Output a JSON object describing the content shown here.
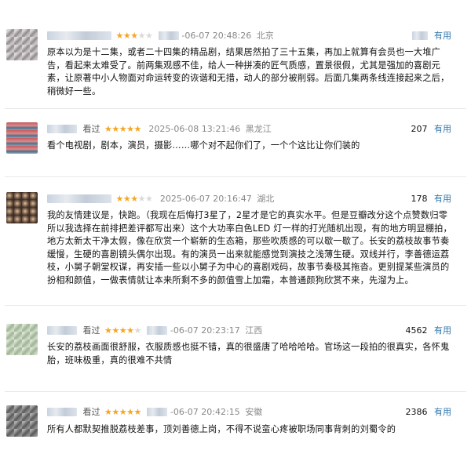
{
  "reviews": [
    {
      "status": "",
      "rating": 3,
      "time": "-06-07 20:48:26",
      "location": "北京",
      "count": "",
      "useful_label": "有用",
      "content": "原本以为是十二集，或者二十四集的精品剧，结果居然拍了三十五集，再加上就算有会员也一大堆广告，看起来太难受了。前两集观感不佳，给人一种拼凑的匠气质感，置景很假，尤其是强加的喜剧元素，让原著中小人物面对命运转变的诙谐和无措，动人的部分被削弱。后面几集两条线连接起来之后，稍微好一些。"
    },
    {
      "status": "看过",
      "rating": 5,
      "time": "2025-06-08 13:21:46",
      "location": "黑龙江",
      "count": "207",
      "useful_label": "有用",
      "content": "看个电视剧，剧本，演员，摄影……哪个对不起你们了，一个个这比让你们装的"
    },
    {
      "status": "",
      "rating": 3,
      "time": "2025-06-07 20:16:47",
      "location": "湖北",
      "count": "178",
      "useful_label": "有用",
      "content": "我的友情建议是，快跑。（我现在后悔打3星了，2星才是它的真实水平。但是豆瓣改分这个点赞数归零所以我选择在前排把差评都写出来）这个大功率白色LED 灯一样的打光随机出现，有的地方明显棚拍，地方太新太干净太假，像在欣赏一个崭新的生态箱，那些吹质感的可以歇一歇了。长安的荔枝故事节奏缓慢，生硬的喜剧镜头偶尔出现。有的演员一出来就能感觉到演技之浅薄生硬。双线并行，李善德运荔枝，小舅子朝堂权谋，再安插一些以小舅子为中心的喜剧戏码，故事节奏极其拖沓。更别提某些演员的扮相和颜值，一做表情就让本来所剩不多的颜值雪上加霜，本普通颜狗欣赏不来，先溜为上。"
    },
    {
      "status": "看过",
      "rating": 4,
      "time": "-06-07 20:23:17",
      "location": "江西",
      "count": "4562",
      "useful_label": "有用",
      "content": "长安的荔枝画面很舒服，衣服质感也挺不错，真的很盛唐了哈哈哈哈。官场这一段拍的很真实，各怀鬼胎，班味极重，真的很难不共情"
    },
    {
      "status": "看过",
      "rating": 5,
      "time": "-06-07 20:42:15",
      "location": "安徽",
      "count": "2386",
      "useful_label": "有用",
      "content": "所有人都默契推脱荔枝差事，顶刘善德上岗，不得不说蛮心疼被职场同事背刺的刘蜀令的"
    }
  ]
}
